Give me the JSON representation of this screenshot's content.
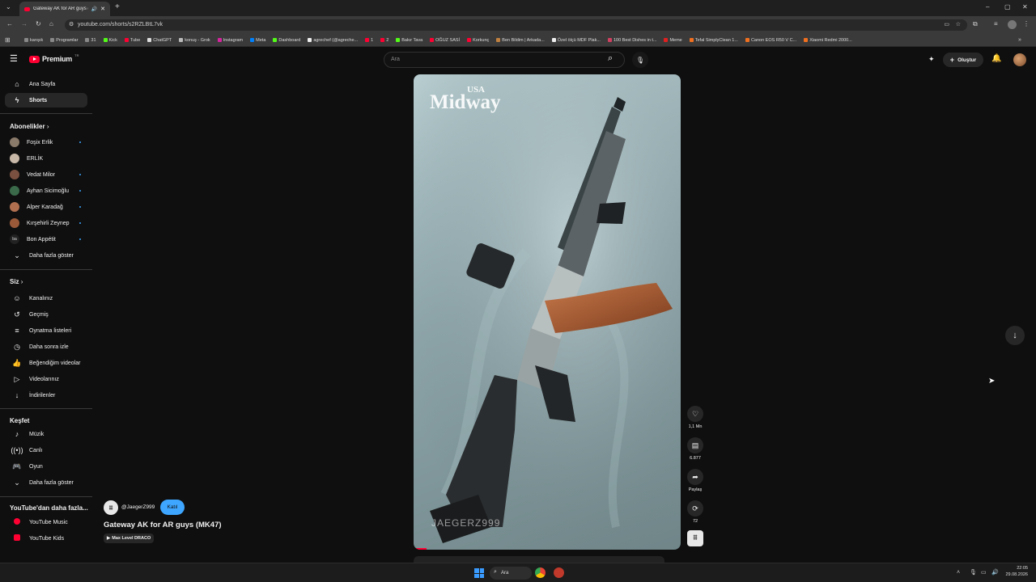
{
  "browser": {
    "tab_title": "Gateway AK for AR guys (MK47)",
    "url": "youtube.com/shorts/s2RZLBtL7vk",
    "bookmarks": [
      "karışık",
      "Programlar",
      "31",
      "Kick",
      "Tube",
      "ChatGPT",
      "konuş - Grok",
      "Instagram",
      "Meta",
      "Dashboard",
      "agrechef (@agreche...",
      "1",
      "2",
      "Bakır Tava",
      "OĞUZ SASİ",
      "Korkunç",
      "Ben Bildim | Arkada...",
      "Özel ölçü MDF Plak...",
      "100 Best Dishes in t...",
      "Meme",
      "Tefal SimplyClean 1...",
      "Canon EOS R50 V C...",
      "Xiaomi Redmi 2000..."
    ]
  },
  "header": {
    "logo_text": "Premium",
    "logo_sup": "TR",
    "search_placeholder": "Ara",
    "create_label": "Oluştur"
  },
  "sidebar": {
    "main": [
      {
        "label": "Ana Sayfa",
        "icon": "home-icon"
      },
      {
        "label": "Shorts",
        "icon": "shorts-icon"
      }
    ],
    "subs_title": "Abonelikler",
    "subs": [
      {
        "label": "Foşix Erlik",
        "color": "#8a7a6a",
        "dot": true
      },
      {
        "label": "ERLİK",
        "color": "#c8b8a8",
        "dot": false
      },
      {
        "label": "Vedat Milor",
        "color": "#7a5040",
        "dot": true
      },
      {
        "label": "Ayhan Sicimoğlu",
        "color": "#3a6a4a",
        "dot": true
      },
      {
        "label": "Alper Karadağ",
        "color": "#b07050",
        "dot": true
      },
      {
        "label": "Kırşehirli Zeynep",
        "color": "#9a5a3a",
        "dot": true
      },
      {
        "label": "Bon Appétit",
        "color": "#222222",
        "dot": true
      }
    ],
    "show_more": "Daha fazla göster",
    "you_title": "Siz",
    "you": [
      {
        "label": "Kanalınız",
        "icon": "channel-icon"
      },
      {
        "label": "Geçmiş",
        "icon": "history-icon"
      },
      {
        "label": "Oynatma listeleri",
        "icon": "playlist-icon"
      },
      {
        "label": "Daha sonra izle",
        "icon": "clock-icon"
      },
      {
        "label": "Beğendiğim videolar",
        "icon": "thumbs-up-icon"
      },
      {
        "label": "Videolarınız",
        "icon": "video-icon"
      },
      {
        "label": "İndirilenler",
        "icon": "download-icon"
      }
    ],
    "explore_title": "Keşfet",
    "explore": [
      {
        "label": "Müzik",
        "icon": "music-icon"
      },
      {
        "label": "Canlı",
        "icon": "live-icon"
      },
      {
        "label": "Oyun",
        "icon": "gaming-icon"
      }
    ],
    "explore_more": "Daha fazla göster",
    "more_title": "YouTube'dan daha fazla...",
    "more": [
      {
        "label": "YouTube Music"
      },
      {
        "label": "YouTube Kids"
      }
    ]
  },
  "short": {
    "channel": "@JaegerZ999",
    "join_label": "Katıl",
    "title": "Gateway AK for AR guys (MK47)",
    "audio": "Max Level DRACO",
    "watermark_top": "USA",
    "watermark_main": "Midway",
    "watermark_bottom": "JAEGERZ999",
    "likes": "1,1 Mn",
    "comments": "6.877",
    "share": "Paylaş",
    "remix": "72"
  },
  "taskbar": {
    "search_label": "Ara",
    "time": "22:05",
    "date": "29.08.2026"
  }
}
